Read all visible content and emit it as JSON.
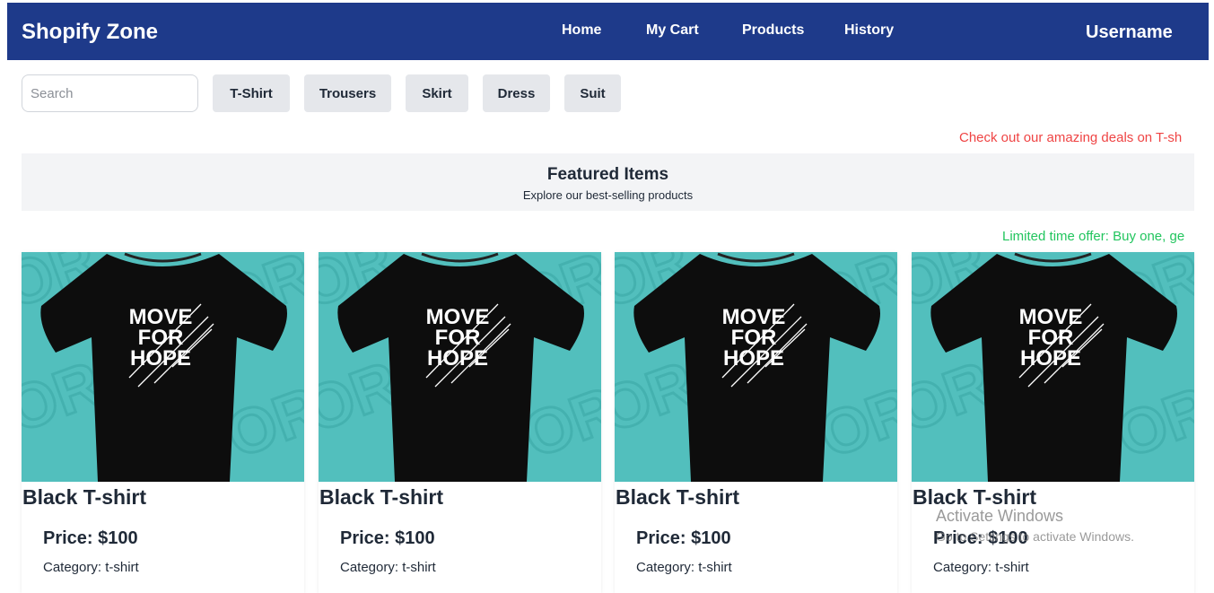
{
  "header": {
    "brand": "Shopify Zone",
    "nav": [
      "Home",
      "My Cart",
      "Products",
      "History"
    ],
    "username": "Username",
    "bg_color": "#1e3a8a"
  },
  "search": {
    "placeholder": "Search",
    "value": ""
  },
  "categories": [
    "T-Shirt",
    "Trousers",
    "Skirt",
    "Dress",
    "Suit"
  ],
  "marquees": [
    {
      "text": "Check out our amazing deals on T-sh",
      "color": "#ef4444"
    },
    {
      "text": "Limited time offer: Buy one, ge",
      "color": "#22c55e"
    }
  ],
  "featured": {
    "title": "Featured Items",
    "subtitle": "Explore our best-selling products"
  },
  "products": [
    {
      "name": "Black T-shirt",
      "price": "Price: $100",
      "category": "Category: t-shirt",
      "shirt_text": [
        "MOVE",
        "FOR",
        "HOPE"
      ]
    },
    {
      "name": "Black T-shirt",
      "price": "Price: $100",
      "category": "Category: t-shirt",
      "shirt_text": [
        "MOVE",
        "FOR",
        "HOPE"
      ]
    },
    {
      "name": "Black T-shirt",
      "price": "Price: $100",
      "category": "Category: t-shirt",
      "shirt_text": [
        "MOVE",
        "FOR",
        "HOPE"
      ]
    },
    {
      "name": "Black T-shirt",
      "price": "Price: $100",
      "category": "Category: t-shirt",
      "shirt_text": [
        "MOVE",
        "FOR",
        "HOPE"
      ]
    }
  ],
  "watermark": {
    "title": "Activate Windows",
    "subtitle": "Go to Settings to activate Windows."
  },
  "colors": {
    "product_bg": "#52bfbd",
    "shirt": "#0d0d0d",
    "chip_bg": "#e5e7eb",
    "featured_bg": "#f3f4f6"
  }
}
